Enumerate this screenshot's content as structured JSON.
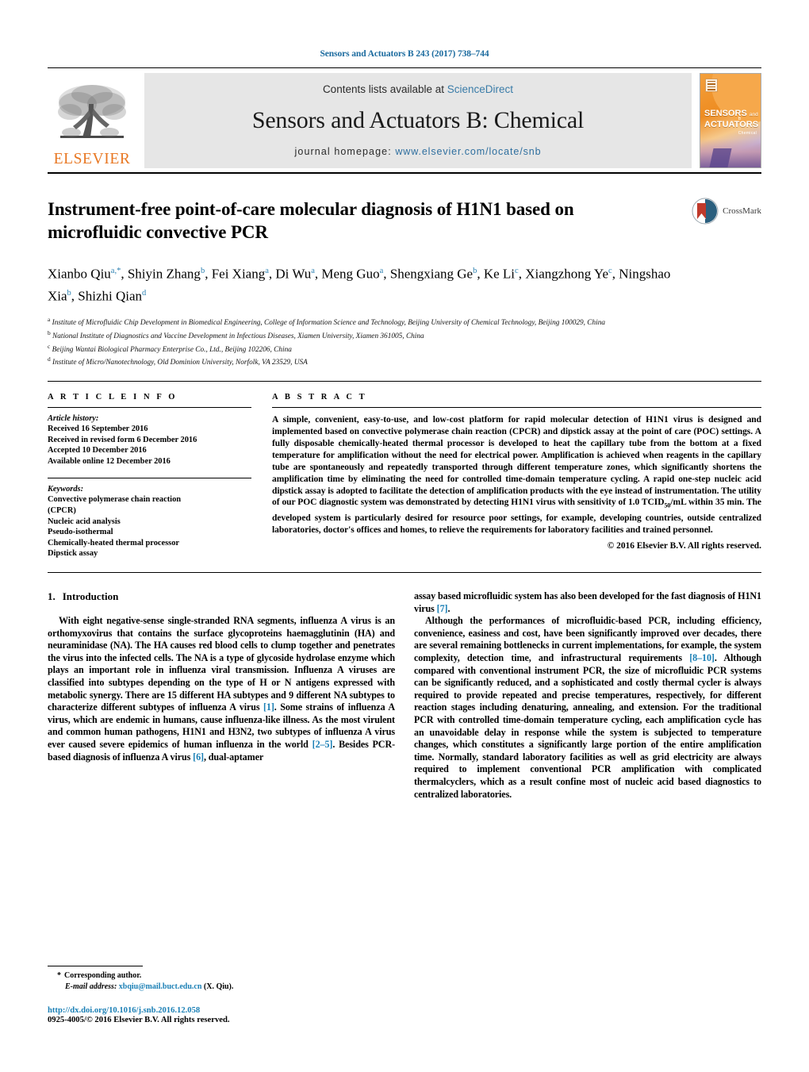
{
  "running_head": "Sensors and Actuators B 243 (2017) 738–744",
  "masthead": {
    "contents_prefix": "Contents lists available at ",
    "contents_link": "ScienceDirect",
    "journal_title": "Sensors and Actuators B: Chemical",
    "homepage_prefix": "journal homepage: ",
    "homepage_url": "www.elsevier.com/locate/snb",
    "publisher_logo_text": "ELSEVIER",
    "cover_title_line1": "SENSORS",
    "cover_title_and": "and",
    "cover_title_line2": "ACTUATORS",
    "cover_letter": "B",
    "cover_letter_sub": "Chemical"
  },
  "article": {
    "title": "Instrument-free point-of-care molecular diagnosis of H1N1 based on microfluidic convective PCR",
    "crossmark_label": "CrossMark",
    "authors_html": "Xianbo Qiu<sup>a,*</sup>, Shiyin Zhang<sup>b</sup>, Fei Xiang<sup>a</sup>, Di Wu<sup>a</sup>, Meng Guo<sup>a</sup>, Shengxiang Ge<sup>b</sup>, Ke Li<sup>c</sup>, Xiangzhong Ye<sup>c</sup>, Ningshao Xia<sup>b</sup>, Shizhi Qian<sup>d</sup>",
    "affiliations": [
      "a Institute of Microfluidic Chip Development in Biomedical Engineering, College of Information Science and Technology, Beijing University of Chemical Technology, Beijing 100029, China",
      "b National Institute of Diagnostics and Vaccine Development in Infectious Diseases, Xiamen University, Xiamen 361005, China",
      "c Beijing Wantai Biological Pharmacy Enterprise Co., Ltd., Beijing 102206, China",
      "d Institute of Micro/Nanotechnology, Old Dominion University, Norfolk, VA 23529, USA"
    ],
    "affiliation_marks": [
      "a",
      "b",
      "c",
      "d"
    ],
    "affiliation_texts": [
      "Institute of Microfluidic Chip Development in Biomedical Engineering, College of Information Science and Technology, Beijing University of Chemical Technology, Beijing 100029, China",
      "National Institute of Diagnostics and Vaccine Development in Infectious Diseases, Xiamen University, Xiamen 361005, China",
      "Beijing Wantai Biological Pharmacy Enterprise Co., Ltd., Beijing 102206, China",
      "Institute of Micro/Nanotechnology, Old Dominion University, Norfolk, VA 23529, USA"
    ]
  },
  "article_info": {
    "heading": "A R T I C L E   I N F O",
    "history_label": "Article history:",
    "history": [
      "Received 16 September 2016",
      "Received in revised form 6 December 2016",
      "Accepted 10 December 2016",
      "Available online 12 December 2016"
    ],
    "keywords_label": "Keywords:",
    "keywords": [
      "Convective polymerase chain reaction",
      "(CPCR)",
      "Nucleic acid analysis",
      "Pseudo-isothermal",
      "Chemically-heated thermal processor",
      "Dipstick assay"
    ]
  },
  "abstract": {
    "heading": "A B S T R A C T",
    "text": "A simple, convenient, easy-to-use, and low-cost platform for rapid molecular detection of H1N1 virus is designed and implemented based on convective polymerase chain reaction (CPCR) and dipstick assay at the point of care (POC) settings. A fully disposable chemically-heated thermal processor is developed to heat the capillary tube from the bottom at a fixed temperature for amplification without the need for electrical power. Amplification is achieved when reagents in the capillary tube are spontaneously and repeatedly transported through different temperature zones, which significantly shortens the amplification time by eliminating the need for controlled time-domain temperature cycling. A rapid one-step nucleic acid dipstick assay is adopted to facilitate the detection of amplification products with the eye instead of instrumentation. The utility of our POC diagnostic system was demonstrated by detecting H1N1 virus with sensitivity of 1.0 TCID50/mL within 35 min. The developed system is particularly desired for resource poor settings, for example, developing countries, outside centralized laboratories, doctor's offices and homes, to relieve the requirements for laboratory facilities and trained personnel.",
    "copyright": "© 2016 Elsevier B.V. All rights reserved."
  },
  "body": {
    "section_number": "1.",
    "section_title": "Introduction",
    "left_paragraphs": [
      "With eight negative-sense single-stranded RNA segments, influenza A virus is an orthomyxovirus that contains the surface glycoproteins haemagglutinin (HA) and neuraminidase (NA). The HA causes red blood cells to clump together and penetrates the virus into the infected cells. The NA is a type of glycoside hydrolase enzyme which plays an important role in influenza viral transmission. Influenza A viruses are classified into subtypes depending on the type of H or N antigens expressed with metabolic synergy. There are 15 different HA subtypes and 9 different NA subtypes to characterize different subtypes of influenza A virus [1]. Some strains of influenza A virus, which are endemic in humans, cause influenza-like illness. As the most virulent and common human pathogens, H1N1 and H3N2, two subtypes of influenza A virus ever caused severe epidemics of human influenza in the world [2–5]. Besides PCR-based diagnosis of influenza A virus [6], dual-aptamer"
    ],
    "right_paragraphs": [
      "assay based microfluidic system has also been developed for the fast diagnosis of H1N1 virus [7].",
      "Although the performances of microfluidic-based PCR, including efficiency, convenience, easiness and cost, have been significantly improved over decades, there are several remaining bottlenecks in current implementations, for example, the system complexity, detection time, and infrastructural requirements [8–10]. Although compared with conventional instrument PCR, the size of microfluidic PCR systems can be significantly reduced, and a sophisticated and costly thermal cycler is always required to provide repeated and precise temperatures, respectively, for different reaction stages including denaturing, annealing, and extension. For the traditional PCR with controlled time-domain temperature cycling, each amplification cycle has an unavoidable delay in response while the system is subjected to temperature changes, which constitutes a significantly large portion of the entire amplification time. Normally, standard laboratory facilities as well as grid electricity are always required to implement conventional PCR amplification with complicated thermalcyclers, which as a result confine most of nucleic acid based diagnostics to centralized laboratories."
    ]
  },
  "footnote": {
    "corresponding_star": "*",
    "corresponding_text": "Corresponding author.",
    "email_label": "E-mail address:",
    "email": "xbqiu@mail.buct.edu.cn",
    "email_suffix": "(X. Qiu).",
    "doi": "http://dx.doi.org/10.1016/j.snb.2016.12.058",
    "issn_line": "0925-4005/© 2016 Elsevier B.V. All rights reserved."
  },
  "colors": {
    "link": "#1a7fb5",
    "header_blue": "#1a6a9e",
    "elsevier_orange": "#E87722",
    "masthead_gray": "#e6e6e6"
  }
}
